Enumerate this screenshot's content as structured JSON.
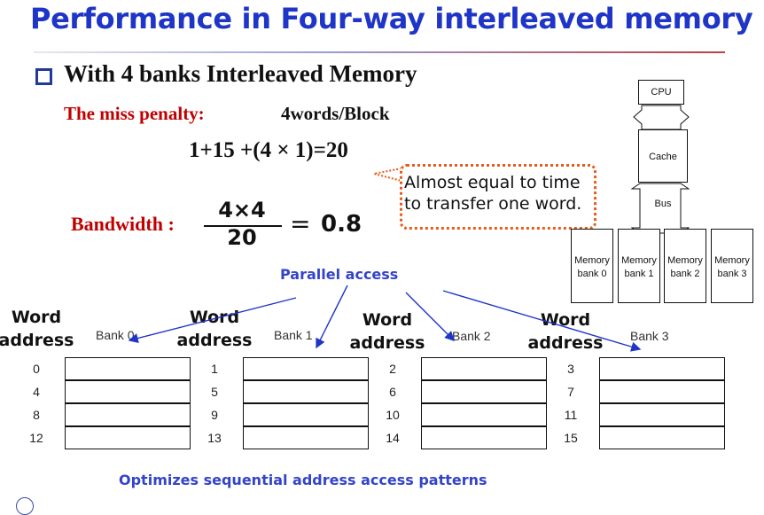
{
  "title": "Performance in Four-way interleaved memory",
  "bullet": "With 4 banks Interleaved Memory",
  "miss_penalty": {
    "label": "The miss penalty:",
    "value": "4words/Block"
  },
  "formula": "1+15 +(4 × 1)=20",
  "bandwidth": {
    "label": "Bandwidth :",
    "numerator": "4×4",
    "denominator": "20",
    "equals": "=",
    "result": "0.8"
  },
  "callout": "Almost equal to time\nto transfer one word.",
  "parallel_access": "Parallel access",
  "optimizes": "Optimizes sequential address access patterns",
  "hardware": {
    "cpu": "CPU",
    "cache": "Cache",
    "bus": "Bus",
    "banks": [
      {
        "line1": "Memory",
        "line2": "bank 0"
      },
      {
        "line1": "Memory",
        "line2": "bank 1"
      },
      {
        "line1": "Memory",
        "line2": "bank 2"
      },
      {
        "line1": "Memory",
        "line2": "bank 3"
      }
    ]
  },
  "word_address": {
    "line1": "Word",
    "line2": "address"
  },
  "banks": [
    {
      "name": "Bank 0",
      "addresses": [
        "0",
        "4",
        "8",
        "12"
      ]
    },
    {
      "name": "Bank 1",
      "addresses": [
        "1",
        "5",
        "9",
        "13"
      ]
    },
    {
      "name": "Bank 2",
      "addresses": [
        "2",
        "6",
        "10",
        "14"
      ]
    },
    {
      "name": "Bank 3",
      "addresses": [
        "3",
        "7",
        "11",
        "15"
      ]
    }
  ]
}
